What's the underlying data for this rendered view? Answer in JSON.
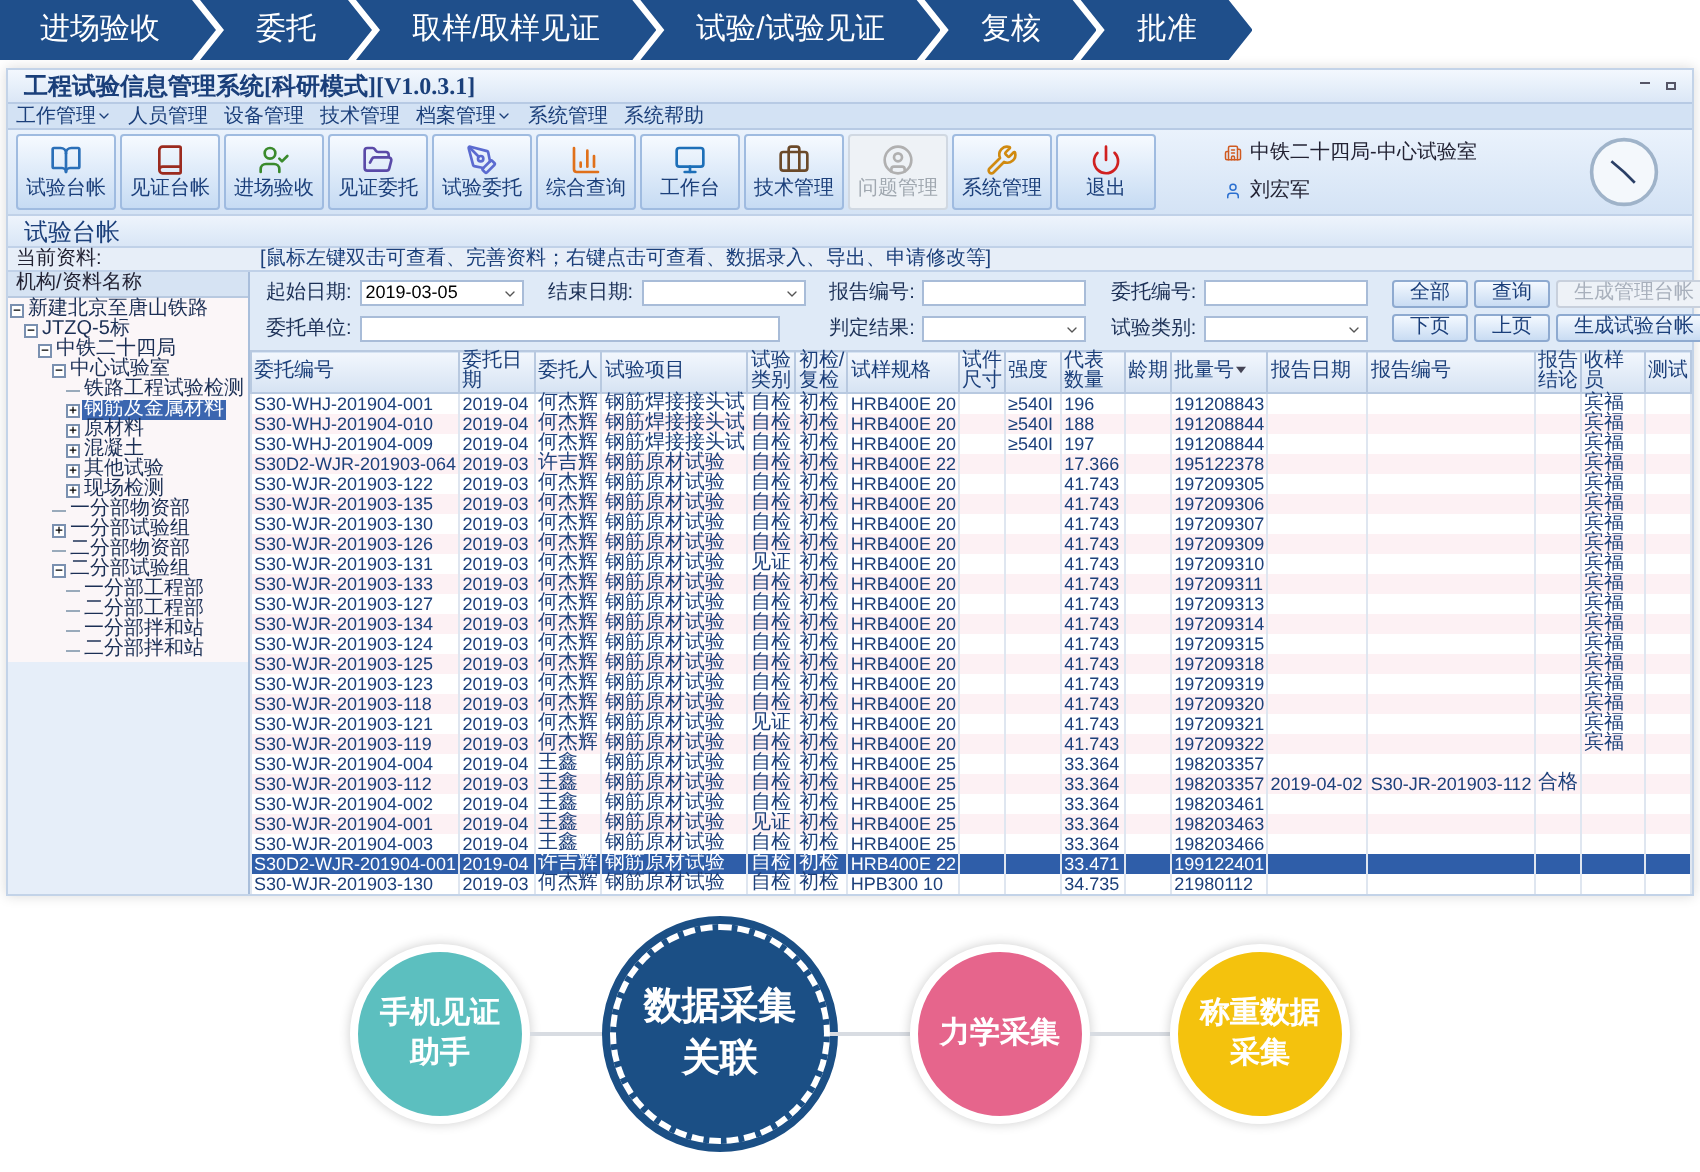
{
  "process_steps": [
    {
      "label": "进场验收"
    },
    {
      "label": "委托"
    },
    {
      "label": "取样/取样见证"
    },
    {
      "label": "试验/试验见证"
    },
    {
      "label": "复核"
    },
    {
      "label": "批准"
    }
  ],
  "app_window": {
    "title": "工程试验信息管理系统[科研模式][V1.0.3.1]",
    "menu": [
      {
        "label": "工作管理",
        "dropdown": true
      },
      {
        "label": "人员管理",
        "dropdown": false
      },
      {
        "label": "设备管理",
        "dropdown": false
      },
      {
        "label": "技术管理",
        "dropdown": false
      },
      {
        "label": "档案管理",
        "dropdown": true
      },
      {
        "label": "系统管理",
        "dropdown": false
      },
      {
        "label": "系统帮助",
        "dropdown": false
      }
    ],
    "toolbar": [
      {
        "label": "试验台帐",
        "disabled": false
      },
      {
        "label": "见证台帐",
        "disabled": false
      },
      {
        "label": "进场验收",
        "disabled": false
      },
      {
        "label": "见证委托",
        "disabled": false
      },
      {
        "label": "试验委托",
        "disabled": false
      },
      {
        "label": "综合查询",
        "disabled": false
      },
      {
        "label": "工作台",
        "disabled": false
      },
      {
        "label": "技术管理",
        "disabled": false
      },
      {
        "label": "问题管理",
        "disabled": true
      },
      {
        "label": "系统管理",
        "disabled": false
      },
      {
        "label": "退出",
        "disabled": false
      }
    ],
    "org": "中铁二十四局-中心试验室",
    "user": "刘宏军",
    "page_title": "试验台帐",
    "current_label": "当前资料:",
    "hint": "[鼠标左键双击可查看、完善资料；右键点击可查看、数据录入、导出、申请修改等]",
    "tree": {
      "header": "机构/资料名称",
      "items": [
        {
          "label": "新建北京至唐山铁路",
          "expanded": true,
          "selected": false,
          "children": [
            {
              "label": "JTZQ-5标",
              "expanded": true,
              "selected": false,
              "children": [
                {
                  "label": "中铁二十四局",
                  "expanded": true,
                  "selected": false,
                  "children": [
                    {
                      "label": "中心试验室",
                      "expanded": true,
                      "selected": false,
                      "children": [
                        {
                          "label": "铁路工程试验检测",
                          "selected": false
                        },
                        {
                          "label": "钢筋及金属材料",
                          "expanded": false,
                          "selected": true
                        },
                        {
                          "label": "原材料",
                          "expanded": false,
                          "selected": false
                        },
                        {
                          "label": "混凝土",
                          "expanded": false,
                          "selected": false
                        },
                        {
                          "label": "其他试验",
                          "expanded": false,
                          "selected": false
                        },
                        {
                          "label": "现场检测",
                          "expanded": false,
                          "selected": false
                        }
                      ]
                    },
                    {
                      "label": "一分部物资部",
                      "selected": false
                    },
                    {
                      "label": "一分部试验组",
                      "expanded": false,
                      "selected": false
                    },
                    {
                      "label": "二分部物资部",
                      "selected": false
                    },
                    {
                      "label": "二分部试验组",
                      "expanded": true,
                      "selected": false,
                      "children": [
                        {
                          "label": "一分部工程部",
                          "selected": false
                        },
                        {
                          "label": "二分部工程部",
                          "selected": false
                        },
                        {
                          "label": "一分部拌和站",
                          "selected": false
                        },
                        {
                          "label": "二分部拌和站",
                          "selected": false
                        }
                      ]
                    }
                  ]
                }
              ]
            }
          ]
        }
      ]
    },
    "filters": [
      {
        "label": "起始日期:",
        "kind": "date",
        "value": "2019-03-05"
      },
      {
        "label": "结束日期:",
        "kind": "select"
      },
      {
        "label": "报告编号:",
        "kind": "text"
      },
      {
        "label": "委托编号:",
        "kind": "text"
      },
      {
        "label": "委托单位:",
        "kind": "wide"
      },
      {
        "label": "判定结果:",
        "kind": "select"
      },
      {
        "label": "试验类别:",
        "kind": "select"
      }
    ],
    "buttons": [
      {
        "label": "全部",
        "disabled": false
      },
      {
        "label": "查询",
        "disabled": false
      },
      {
        "label": "生成管理台帐",
        "disabled": true
      },
      {
        "label": "下页",
        "disabled": false
      },
      {
        "label": "上页",
        "disabled": false
      },
      {
        "label": "生成试验台帐",
        "disabled": false
      }
    ],
    "table": {
      "columns": [
        {
          "label": "委托编号",
          "sorted": false
        },
        {
          "label": "委托日期",
          "sorted": false
        },
        {
          "label": "委托人",
          "sorted": false
        },
        {
          "label": "试验项目",
          "sorted": false
        },
        {
          "label": "试验类别",
          "sorted": false
        },
        {
          "label": "初检/复检",
          "sorted": false
        },
        {
          "label": "试样规格",
          "sorted": false
        },
        {
          "label": "试件尺寸",
          "sorted": false
        },
        {
          "label": "强度",
          "sorted": false
        },
        {
          "label": "代表数量",
          "sorted": false
        },
        {
          "label": "龄期",
          "sorted": false
        },
        {
          "label": "批量号",
          "sorted": true
        },
        {
          "label": "报告日期",
          "sorted": false
        },
        {
          "label": "报告编号",
          "sorted": false
        },
        {
          "label": "报告结论",
          "sorted": false
        },
        {
          "label": "收样员",
          "sorted": false
        },
        {
          "label": "测试",
          "sorted": false
        }
      ],
      "rows": [
        {
          "selected": false,
          "cells": [
            "S30-WHJ-201904-001",
            "2019-04",
            "何杰辉",
            "钢筋焊接接头试",
            "自检",
            "初检",
            "HRB400E 20",
            null,
            "≥540I",
            "196",
            null,
            "191208843",
            null,
            null,
            null,
            "宾福",
            null
          ]
        },
        {
          "selected": false,
          "cells": [
            "S30-WHJ-201904-010",
            "2019-04",
            "何杰辉",
            "钢筋焊接接头试",
            "自检",
            "初检",
            "HRB400E 20",
            null,
            "≥540I",
            "188",
            null,
            "191208844",
            null,
            null,
            null,
            "宾福",
            null
          ]
        },
        {
          "selected": false,
          "cells": [
            "S30-WHJ-201904-009",
            "2019-04",
            "何杰辉",
            "钢筋焊接接头试",
            "自检",
            "初检",
            "HRB400E 20",
            null,
            "≥540I",
            "197",
            null,
            "191208844",
            null,
            null,
            null,
            "宾福",
            null
          ]
        },
        {
          "selected": false,
          "cells": [
            "S30D2-WJR-201903-064",
            "2019-03",
            "许吉辉",
            "钢筋原材试验",
            "自检",
            "初检",
            "HRB400E 22",
            null,
            null,
            "17.366",
            null,
            "195122378",
            null,
            null,
            null,
            "宾福",
            null
          ]
        },
        {
          "selected": false,
          "cells": [
            "S30-WJR-201903-122",
            "2019-03",
            "何杰辉",
            "钢筋原材试验",
            "自检",
            "初检",
            "HRB400E 20",
            null,
            null,
            "41.743",
            null,
            "197209305",
            null,
            null,
            null,
            "宾福",
            null
          ]
        },
        {
          "selected": false,
          "cells": [
            "S30-WJR-201903-135",
            "2019-03",
            "何杰辉",
            "钢筋原材试验",
            "自检",
            "初检",
            "HRB400E 20",
            null,
            null,
            "41.743",
            null,
            "197209306",
            null,
            null,
            null,
            "宾福",
            null
          ]
        },
        {
          "selected": false,
          "cells": [
            "S30-WJR-201903-130",
            "2019-03",
            "何杰辉",
            "钢筋原材试验",
            "自检",
            "初检",
            "HRB400E 20",
            null,
            null,
            "41.743",
            null,
            "197209307",
            null,
            null,
            null,
            "宾福",
            null
          ]
        },
        {
          "selected": false,
          "cells": [
            "S30-WJR-201903-126",
            "2019-03",
            "何杰辉",
            "钢筋原材试验",
            "自检",
            "初检",
            "HRB400E 20",
            null,
            null,
            "41.743",
            null,
            "197209309",
            null,
            null,
            null,
            "宾福",
            null
          ]
        },
        {
          "selected": false,
          "cells": [
            "S30-WJR-201903-131",
            "2019-03",
            "何杰辉",
            "钢筋原材试验",
            "见证",
            "初检",
            "HRB400E 20",
            null,
            null,
            "41.743",
            null,
            "197209310",
            null,
            null,
            null,
            "宾福",
            null
          ]
        },
        {
          "selected": false,
          "cells": [
            "S30-WJR-201903-133",
            "2019-03",
            "何杰辉",
            "钢筋原材试验",
            "自检",
            "初检",
            "HRB400E 20",
            null,
            null,
            "41.743",
            null,
            "197209311",
            null,
            null,
            null,
            "宾福",
            null
          ]
        },
        {
          "selected": false,
          "cells": [
            "S30-WJR-201903-127",
            "2019-03",
            "何杰辉",
            "钢筋原材试验",
            "自检",
            "初检",
            "HRB400E 20",
            null,
            null,
            "41.743",
            null,
            "197209313",
            null,
            null,
            null,
            "宾福",
            null
          ]
        },
        {
          "selected": false,
          "cells": [
            "S30-WJR-201903-134",
            "2019-03",
            "何杰辉",
            "钢筋原材试验",
            "自检",
            "初检",
            "HRB400E 20",
            null,
            null,
            "41.743",
            null,
            "197209314",
            null,
            null,
            null,
            "宾福",
            null
          ]
        },
        {
          "selected": false,
          "cells": [
            "S30-WJR-201903-124",
            "2019-03",
            "何杰辉",
            "钢筋原材试验",
            "自检",
            "初检",
            "HRB400E 20",
            null,
            null,
            "41.743",
            null,
            "197209315",
            null,
            null,
            null,
            "宾福",
            null
          ]
        },
        {
          "selected": false,
          "cells": [
            "S30-WJR-201903-125",
            "2019-03",
            "何杰辉",
            "钢筋原材试验",
            "自检",
            "初检",
            "HRB400E 20",
            null,
            null,
            "41.743",
            null,
            "197209318",
            null,
            null,
            null,
            "宾福",
            null
          ]
        },
        {
          "selected": false,
          "cells": [
            "S30-WJR-201903-123",
            "2019-03",
            "何杰辉",
            "钢筋原材试验",
            "自检",
            "初检",
            "HRB400E 20",
            null,
            null,
            "41.743",
            null,
            "197209319",
            null,
            null,
            null,
            "宾福",
            null
          ]
        },
        {
          "selected": false,
          "cells": [
            "S30-WJR-201903-118",
            "2019-03",
            "何杰辉",
            "钢筋原材试验",
            "自检",
            "初检",
            "HRB400E 20",
            null,
            null,
            "41.743",
            null,
            "197209320",
            null,
            null,
            null,
            "宾福",
            null
          ]
        },
        {
          "selected": false,
          "cells": [
            "S30-WJR-201903-121",
            "2019-03",
            "何杰辉",
            "钢筋原材试验",
            "见证",
            "初检",
            "HRB400E 20",
            null,
            null,
            "41.743",
            null,
            "197209321",
            null,
            null,
            null,
            "宾福",
            null
          ]
        },
        {
          "selected": false,
          "cells": [
            "S30-WJR-201903-119",
            "2019-03",
            "何杰辉",
            "钢筋原材试验",
            "自检",
            "初检",
            "HRB400E 20",
            null,
            null,
            "41.743",
            null,
            "197209322",
            null,
            null,
            null,
            "宾福",
            null
          ]
        },
        {
          "selected": false,
          "cells": [
            "S30-WJR-201904-004",
            "2019-04",
            "王鑫",
            "钢筋原材试验",
            "自检",
            "初检",
            "HRB400E 25",
            null,
            null,
            "33.364",
            null,
            "198203357",
            null,
            null,
            null,
            null,
            null
          ]
        },
        {
          "selected": false,
          "cells": [
            "S30-WJR-201903-112",
            "2019-03",
            "王鑫",
            "钢筋原材试验",
            "自检",
            "初检",
            "HRB400E 25",
            null,
            null,
            "33.364",
            null,
            "198203357",
            "2019-04-02",
            "S30-JR-201903-112",
            "合格",
            null,
            null
          ]
        },
        {
          "selected": false,
          "cells": [
            "S30-WJR-201904-002",
            "2019-04",
            "王鑫",
            "钢筋原材试验",
            "自检",
            "初检",
            "HRB400E 25",
            null,
            null,
            "33.364",
            null,
            "198203461",
            null,
            null,
            null,
            null,
            null
          ]
        },
        {
          "selected": false,
          "cells": [
            "S30-WJR-201904-001",
            "2019-04",
            "王鑫",
            "钢筋原材试验",
            "见证",
            "初检",
            "HRB400E 25",
            null,
            null,
            "33.364",
            null,
            "198203463",
            null,
            null,
            null,
            null,
            null
          ]
        },
        {
          "selected": false,
          "cells": [
            "S30-WJR-201904-003",
            "2019-04",
            "王鑫",
            "钢筋原材试验",
            "自检",
            "初检",
            "HRB400E 25",
            null,
            null,
            "33.364",
            null,
            "198203466",
            null,
            null,
            null,
            null,
            null
          ]
        },
        {
          "selected": true,
          "cells": [
            "S30D2-WJR-201904-001",
            "2019-04",
            "许吉辉",
            "钢筋原材试验",
            "自检",
            "初检",
            "HRB400E 22",
            null,
            null,
            "33.471",
            null,
            "199122401",
            null,
            null,
            null,
            null,
            null
          ]
        },
        {
          "selected": false,
          "cells": [
            "S30-WJR-201903-130",
            "2019-03",
            "何杰辉",
            "钢筋原材试验",
            "自检",
            "初检",
            "HPB300 10",
            null,
            null,
            "34.735",
            null,
            "21980112",
            null,
            null,
            null,
            null,
            null
          ]
        }
      ]
    }
  },
  "features": [
    {
      "label": "手机见证助手",
      "kind": "small",
      "color": "#5cbfbf"
    },
    {
      "label": "数据采集关联",
      "kind": "main",
      "color": "#1b4f85"
    },
    {
      "label": "力学采集",
      "kind": "small",
      "color": "#e6658c"
    },
    {
      "label": "称重数据采集",
      "kind": "small",
      "color": "#f4c20d"
    }
  ]
}
